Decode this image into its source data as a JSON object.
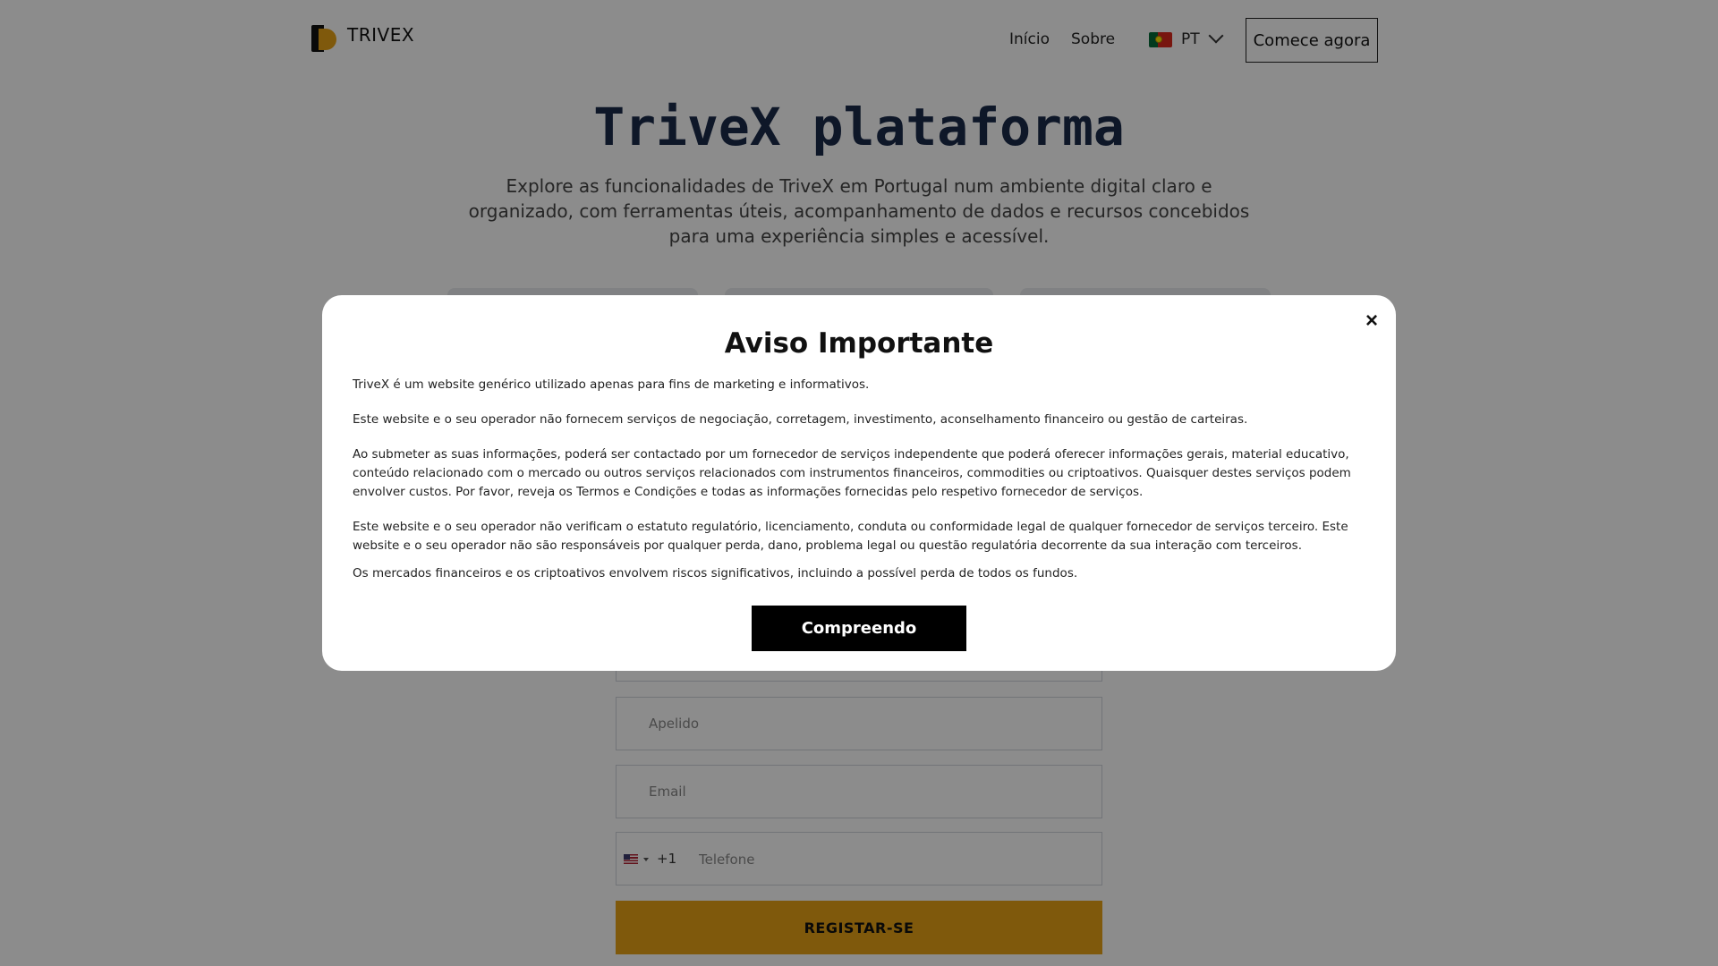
{
  "header": {
    "brand": "TRIVEX",
    "nav": {
      "home": "Início",
      "about": "Sobre"
    },
    "language": {
      "code": "PT",
      "flag_icon": "flag-portugal-icon"
    },
    "cta_label": "Comece agora"
  },
  "hero": {
    "title": "TriveX plataforma",
    "subtitle": "Explore as funcionalidades de TriveX em Portugal num ambiente digital claro e organizado, com ferramentas úteis, acompanhamento de dados e recursos concebidos para uma experiência simples e acessível."
  },
  "form": {
    "last_name_placeholder": "Apelido",
    "email_placeholder": "Email",
    "phone": {
      "country_icon": "flag-usa-icon",
      "dial_code": "+1",
      "placeholder": "Telefone"
    },
    "submit_label": "REGISTAR-SE"
  },
  "modal": {
    "close_symbol": "×",
    "title": "Aviso Importante",
    "paragraphs": [
      "TriveX é um website genérico utilizado apenas para fins de marketing e informativos.",
      "Este website e o seu operador não fornecem serviços de negociação, corretagem, investimento, aconselhamento financeiro ou gestão de carteiras.",
      "Ao submeter as suas informações, poderá ser contactado por um fornecedor de serviços independente que poderá oferecer informações gerais, material educativo, conteúdo relacionado com o mercado ou outros serviços relacionados com instrumentos financeiros, commodities ou criptoativos. Quaisquer destes serviços podem envolver custos. Por favor, reveja os Termos e Condições e todas as informações fornecidas pelo respetivo fornecedor de serviços.",
      "Este website e o seu operador não verificam o estatuto regulatório, licenciamento, conduta ou conformidade legal de qualquer fornecedor de serviços terceiro. Este website e o seu operador não são responsáveis por qualquer perda, dano, problema legal ou questão regulatória decorrente da sua interação com terceiros.",
      "Os mercados financeiros e os criptoativos envolvem riscos significativos, incluindo a possível perda de todos os fundos."
    ],
    "button_label": "Compreendo"
  },
  "colors": {
    "accent": "#e8a317",
    "title_color": "#1b2a4a",
    "overlay": "rgba(0,0,0,0.45)",
    "modal_button": "#000000"
  }
}
